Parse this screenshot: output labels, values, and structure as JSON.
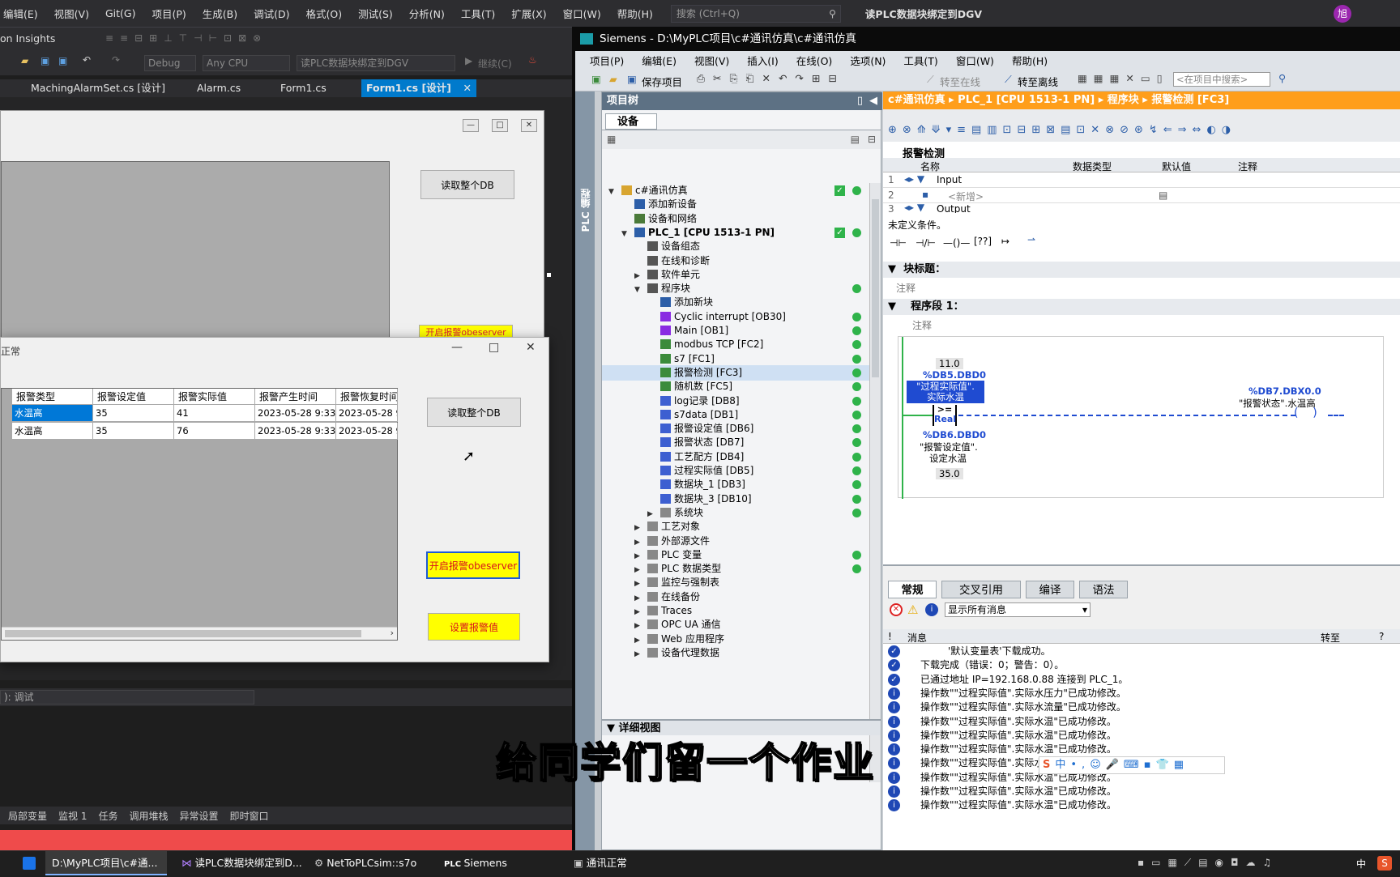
{
  "vs": {
    "menu": [
      "编辑(E)",
      "视图(V)",
      "Git(G)",
      "项目(P)",
      "生成(B)",
      "调试(D)",
      "格式(O)",
      "测试(S)",
      "分析(N)",
      "工具(T)",
      "扩展(X)",
      "窗口(W)",
      "帮助(H)"
    ],
    "search_placeholder": "搜索 (Ctrl+Q)",
    "window_title": "读PLC数据块绑定到DGV",
    "avatar": "旭",
    "insights_label": "on Insights",
    "config": "Debug",
    "platform": "Any CPU",
    "startup_project": "读PLC数据块绑定到DGV",
    "continue_label": "继续(C)",
    "tabs": [
      "MachingAlarmSet.cs [设计]",
      "Alarm.cs",
      "Form1.cs",
      "Form1.cs [设计]"
    ],
    "debug_location": "调试",
    "bottom_tabs": [
      "局部变量",
      "监视 1",
      "任务",
      "调用堆栈",
      "异常设置",
      "即时窗口"
    ]
  },
  "form1": {
    "btn_read": "读取整个DB",
    "btn_partial": "开启报警obeserver"
  },
  "form2": {
    "title": "正常",
    "columns": [
      "报警类型",
      "报警设定值",
      "报警实际值",
      "报警产生时间",
      "报警恢复时间"
    ],
    "rows": [
      [
        "水温高",
        "35",
        "41",
        "2023-05-28 9:33",
        "2023-05-28 9"
      ],
      [
        "水温高",
        "35",
        "76",
        "2023-05-28 9:33",
        "2023-05-28 9"
      ]
    ],
    "btn_read": "读取整个DB",
    "btn_observer": "开启报警obeserver",
    "btn_set": "设置报警值"
  },
  "taskbar": {
    "items": [
      "D:\\MyPLC项目\\c#通...",
      "读PLC数据块绑定到D...",
      "NetToPLCsim::s7o",
      "Siemens",
      "通讯正常"
    ],
    "tray": [
      "中",
      "S"
    ]
  },
  "tia": {
    "title": "Siemens  -  D:\\MyPLC项目\\c#通讯仿真\\c#通讯仿真",
    "menu": [
      "项目(P)",
      "编辑(E)",
      "视图(V)",
      "插入(I)",
      "在线(O)",
      "选项(N)",
      "工具(T)",
      "窗口(W)",
      "帮助(H)"
    ],
    "save_label": "保存项目",
    "go_online": "转至在线",
    "go_offline": "转至离线",
    "search_placeholder": "<在项目中搜索>",
    "side_label": "PLC 编程",
    "tree_header": "项目树",
    "devices_tab": "设备",
    "tree": [
      {
        "label": "c#通讯仿真",
        "indent": 0,
        "arrow": "▼",
        "check": true,
        "dot": true
      },
      {
        "label": "添加新设备",
        "indent": 1,
        "arrow": "",
        "check": false,
        "dot": false
      },
      {
        "label": "设备和网络",
        "indent": 1,
        "arrow": "",
        "check": false,
        "dot": false
      },
      {
        "label": "PLC_1 [CPU 1513-1 PN]",
        "indent": 1,
        "arrow": "▼",
        "check": true,
        "dot": true
      },
      {
        "label": "设备组态",
        "indent": 2,
        "arrow": "",
        "check": false,
        "dot": false
      },
      {
        "label": "在线和诊断",
        "indent": 2,
        "arrow": "",
        "check": false,
        "dot": false
      },
      {
        "label": "软件单元",
        "indent": 2,
        "arrow": "▶",
        "check": false,
        "dot": false
      },
      {
        "label": "程序块",
        "indent": 2,
        "arrow": "▼",
        "check": false,
        "dot": true
      },
      {
        "label": "添加新块",
        "indent": 3,
        "arrow": "",
        "check": false,
        "dot": false
      },
      {
        "label": "Cyclic interrupt [OB30]",
        "indent": 3,
        "arrow": "",
        "check": false,
        "dot": true
      },
      {
        "label": "Main [OB1]",
        "indent": 3,
        "arrow": "",
        "check": false,
        "dot": true
      },
      {
        "label": "modbus TCP [FC2]",
        "indent": 3,
        "arrow": "",
        "check": false,
        "dot": true
      },
      {
        "label": "s7 [FC1]",
        "indent": 3,
        "arrow": "",
        "check": false,
        "dot": true
      },
      {
        "label": "报警检测 [FC3]",
        "indent": 3,
        "arrow": "",
        "check": false,
        "dot": true
      },
      {
        "label": "随机数 [FC5]",
        "indent": 3,
        "arrow": "",
        "check": false,
        "dot": true
      },
      {
        "label": "log记录 [DB8]",
        "indent": 3,
        "arrow": "",
        "check": false,
        "dot": true
      },
      {
        "label": "s7data [DB1]",
        "indent": 3,
        "arrow": "",
        "check": false,
        "dot": true
      },
      {
        "label": "报警设定值 [DB6]",
        "indent": 3,
        "arrow": "",
        "check": false,
        "dot": true
      },
      {
        "label": "报警状态 [DB7]",
        "indent": 3,
        "arrow": "",
        "check": false,
        "dot": true
      },
      {
        "label": "工艺配方 [DB4]",
        "indent": 3,
        "arrow": "",
        "check": false,
        "dot": true
      },
      {
        "label": "过程实际值 [DB5]",
        "indent": 3,
        "arrow": "",
        "check": false,
        "dot": true
      },
      {
        "label": "数据块_1 [DB3]",
        "indent": 3,
        "arrow": "",
        "check": false,
        "dot": true
      },
      {
        "label": "数据块_3 [DB10]",
        "indent": 3,
        "arrow": "",
        "check": false,
        "dot": true
      },
      {
        "label": "系统块",
        "indent": 3,
        "arrow": "▶",
        "check": false,
        "dot": true
      },
      {
        "label": "工艺对象",
        "indent": 2,
        "arrow": "▶",
        "check": false,
        "dot": false
      },
      {
        "label": "外部源文件",
        "indent": 2,
        "arrow": "▶",
        "check": false,
        "dot": false
      },
      {
        "label": "PLC 变量",
        "indent": 2,
        "arrow": "▶",
        "check": false,
        "dot": true
      },
      {
        "label": "PLC 数据类型",
        "indent": 2,
        "arrow": "▶",
        "check": false,
        "dot": true
      },
      {
        "label": "监控与强制表",
        "indent": 2,
        "arrow": "▶",
        "check": false,
        "dot": false
      },
      {
        "label": "在线备份",
        "indent": 2,
        "arrow": "▶",
        "check": false,
        "dot": false
      },
      {
        "label": "Traces",
        "indent": 2,
        "arrow": "▶",
        "check": false,
        "dot": false
      },
      {
        "label": "OPC UA 通信",
        "indent": 2,
        "arrow": "▶",
        "check": false,
        "dot": false
      },
      {
        "label": "Web 应用程序",
        "indent": 2,
        "arrow": "▶",
        "check": false,
        "dot": false
      },
      {
        "label": "设备代理数据",
        "indent": 2,
        "arrow": "▶",
        "check": false,
        "dot": false
      }
    ],
    "detail_header": "详细视图",
    "breadcrumb": "c#通讯仿真  ▸  PLC_1 [CPU 1513-1 PN]  ▸  程序块  ▸  报警检测 [FC3]",
    "block_name": "报警检测",
    "iface_cols": [
      "名称",
      "数据类型",
      "默认值",
      "注释"
    ],
    "iface_rows": [
      {
        "num": "1",
        "name": "Input"
      },
      {
        "num": "2",
        "name": "<新增>"
      },
      {
        "num": "3",
        "name": "Output"
      }
    ],
    "undefined_cond": "未定义条件。",
    "block_title": "块标题：",
    "comment": "注释",
    "network": "程序段 1：",
    "ladder": {
      "in1_value": "11.0",
      "in1_addr": "%DB5.DBD0",
      "in1_name1": "\"过程实际值\".",
      "in1_name2": "实际水温",
      "op": ">=",
      "type": "Real",
      "in2_addr": "%DB6.DBD0",
      "in2_name1": "\"报警设定值\".",
      "in2_name2": "设定水温",
      "in2_value": "35.0",
      "coil_addr": "%DB7.DBX0.0",
      "coil_name": "\"报警状态\".水温高"
    },
    "info_tabs": [
      "常规",
      "交叉引用",
      "编译",
      "语法"
    ],
    "filter": "显示所有消息",
    "msg_cols": [
      "!",
      "消息",
      "转至",
      "?"
    ],
    "messages": [
      {
        "type": "ok",
        "text": "'默认变量表'下载成功。",
        "indent": true
      },
      {
        "type": "ok",
        "text": "下载完成（错误：0；警告：0）。",
        "indent": false
      },
      {
        "type": "ok",
        "text": "已通过地址 IP=192.168.0.88 连接到 PLC_1。",
        "indent": false
      },
      {
        "type": "info",
        "text": "操作数\"\"过程实际值\".实际水压力\"已成功修改。",
        "indent": false
      },
      {
        "type": "info",
        "text": "操作数\"\"过程实际值\".实际水流量\"已成功修改。",
        "indent": false
      },
      {
        "type": "info",
        "text": "操作数\"\"过程实际值\".实际水温\"已成功修改。",
        "indent": false
      },
      {
        "type": "info",
        "text": "操作数\"\"过程实际值\".实际水温\"已成功修改。",
        "indent": false
      },
      {
        "type": "info",
        "text": "操作数\"\"过程实际值\".实际水温\"已成功修改。",
        "indent": false
      },
      {
        "type": "info",
        "text": "操作数\"\"过程实际值\".实际水压力\"已成功修改。",
        "indent": false
      },
      {
        "type": "info",
        "text": "操作数\"\"过程实际值\".实际水温\"已成功修改。",
        "indent": false
      },
      {
        "type": "info",
        "text": "操作数\"\"过程实际值\".实际水温\"已成功修改。",
        "indent": false
      },
      {
        "type": "info",
        "text": "操作数\"\"过程实际值\".实际水温\"已成功修改。",
        "indent": false
      }
    ]
  },
  "subtitle": "给同学们留一个作业",
  "colors": {
    "tia_orange": "#ff9e1b",
    "ladder_blue": "#1f4bd1",
    "ok_green": "#2fb34a",
    "highlight_yellow": "#ffff00"
  }
}
